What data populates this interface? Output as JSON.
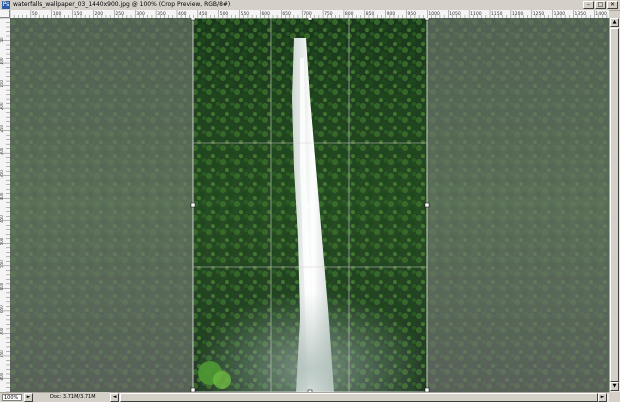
{
  "window": {
    "title": "waterfalls_wallpaper_03_1440x900.jpg @ 100% (Crop Preview, RGB/8#)",
    "app_icon_label": "Ps",
    "minimize_glyph": "–",
    "maximize_glyph": "□",
    "close_glyph": "✕"
  },
  "rulers": {
    "horizontal_ticks": [
      "50",
      "100",
      "150",
      "200",
      "250",
      "300",
      "350",
      "400",
      "450",
      "500",
      "550",
      "600",
      "650",
      "700",
      "750",
      "800",
      "850",
      "900",
      "950",
      "1000",
      "1050",
      "1100",
      "1150",
      "1200",
      "1250",
      "1300",
      "1350",
      "1400"
    ],
    "vertical_ticks": [
      "50",
      "100",
      "150",
      "200",
      "250",
      "300",
      "350",
      "400",
      "450",
      "500",
      "550",
      "600",
      "650",
      "700",
      "750",
      "800"
    ]
  },
  "status": {
    "zoom": "100%",
    "doc_info": "Doc: 3.71M/3.71M",
    "arrow_right": "►",
    "arrow_left": "◄",
    "arrow_up": "▲",
    "arrow_down": "▼"
  },
  "crop": {
    "selection_fraction_left": 0.305,
    "selection_fraction_right": 0.695
  },
  "colors": {
    "chrome": "#d4d0c8",
    "crop_shield": "#808080",
    "crop_shield_opacity": "0.55"
  }
}
